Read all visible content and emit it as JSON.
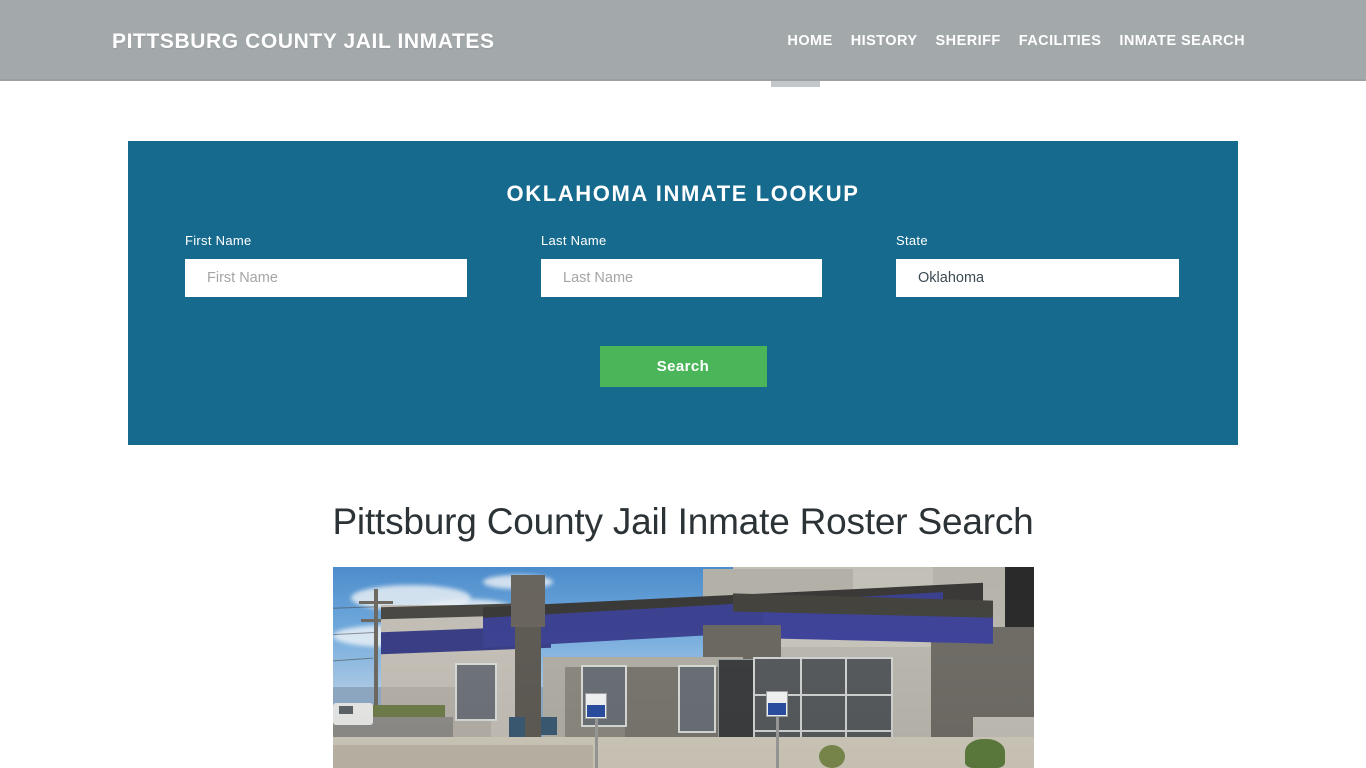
{
  "header": {
    "brand": "PITTSBURG COUNTY JAIL INMATES",
    "nav": [
      {
        "label": "HOME",
        "active": true
      },
      {
        "label": "HISTORY",
        "active": false
      },
      {
        "label": "SHERIFF",
        "active": false
      },
      {
        "label": "FACILITIES",
        "active": false
      },
      {
        "label": "INMATE SEARCH",
        "active": false
      }
    ],
    "background_color": "#a3a8ab",
    "text_color": "#ffffff",
    "active_indicator_color": "#c3c7c9"
  },
  "lookup": {
    "title": "OKLAHOMA INMATE LOOKUP",
    "panel_color": "#166a8e",
    "fields": {
      "first_name": {
        "label": "First Name",
        "placeholder": "First Name",
        "value": ""
      },
      "last_name": {
        "label": "Last Name",
        "placeholder": "Last Name",
        "value": ""
      },
      "state": {
        "label": "State",
        "placeholder": "State",
        "value": "Oklahoma"
      }
    },
    "search_button": {
      "label": "Search",
      "color": "#4bb55a"
    }
  },
  "article": {
    "heading": "Pittsburg County Jail Inmate Roster Search",
    "photo_alt": "Pittsburg County Jail building exterior"
  }
}
